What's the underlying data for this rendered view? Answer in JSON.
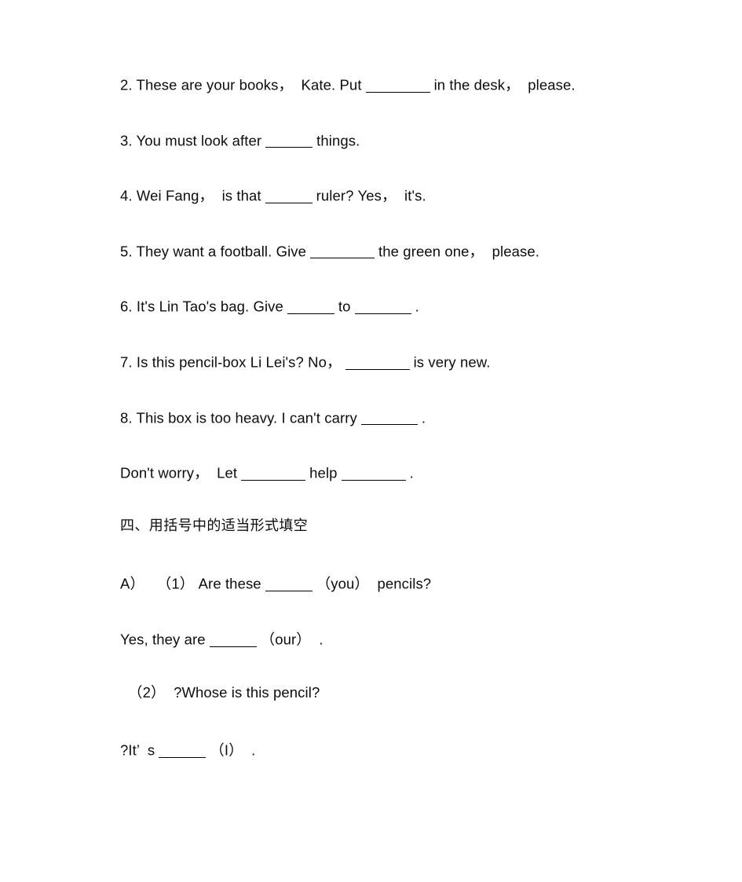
{
  "document": {
    "type": "english-grammar-worksheet",
    "page_background": "#ffffff",
    "text_color": "#0d0d0d",
    "rule_color": "#000000"
  },
  "exercises": {
    "items": [
      {
        "id": "q2",
        "number": "2.",
        "before": " These are your books，  Kate. Put",
        "blank": "w-l",
        "after": "in the desk，  please."
      },
      {
        "id": "q3",
        "number": "3.",
        "before": " You must look after",
        "blank": "w-s",
        "after": "things."
      },
      {
        "id": "q4",
        "number": "4.",
        "before": " Wei Fang，  is that",
        "blank": "w-s",
        "after": "ruler? Yes，  it's."
      },
      {
        "id": "q5",
        "number": "5.",
        "before": " They want a football. Give",
        "blank": "w-l",
        "after": "the green one，  please."
      },
      {
        "id": "q6",
        "number": "6.",
        "before": " It's Lin Tao's bag. Give",
        "blank": "w-s",
        "mid": "to",
        "blank2": "w-m",
        "after": "."
      },
      {
        "id": "q7",
        "number": "7.",
        "before": " Is this pencil-box Li Lei's? No，",
        "blank": "w-l",
        "after": "is very new."
      },
      {
        "id": "q8",
        "number": "8.",
        "before": " This box is too heavy. I can't carry",
        "blank": "w-m",
        "after": "."
      },
      {
        "id": "dont-worry",
        "number": "",
        "before": "Don't worry，  Let",
        "blank": "w-l",
        "mid": "help",
        "blank2": "w-l",
        "after": "."
      }
    ]
  },
  "section_four": {
    "heading": "四、用括号中的适当形式填空",
    "part_a_label": "A）",
    "lines": [
      {
        "id": "a-1",
        "prefix": "（1）",
        "before": " Are these",
        "blank": "w-s",
        "after": "（you）  pencils?"
      },
      {
        "id": "a-1-answer",
        "prefix": "",
        "before": "Yes, they are",
        "blank": "w-s",
        "after": "（our）  ."
      },
      {
        "id": "a-2",
        "prefix": "（2）",
        "before": "  ?Whose is this pencil?",
        "blank": "",
        "after": ""
      },
      {
        "id": "a-2-answer",
        "prefix": "",
        "before": "?It’  s",
        "blank": "w-s",
        "after": "（I）  ."
      }
    ]
  }
}
